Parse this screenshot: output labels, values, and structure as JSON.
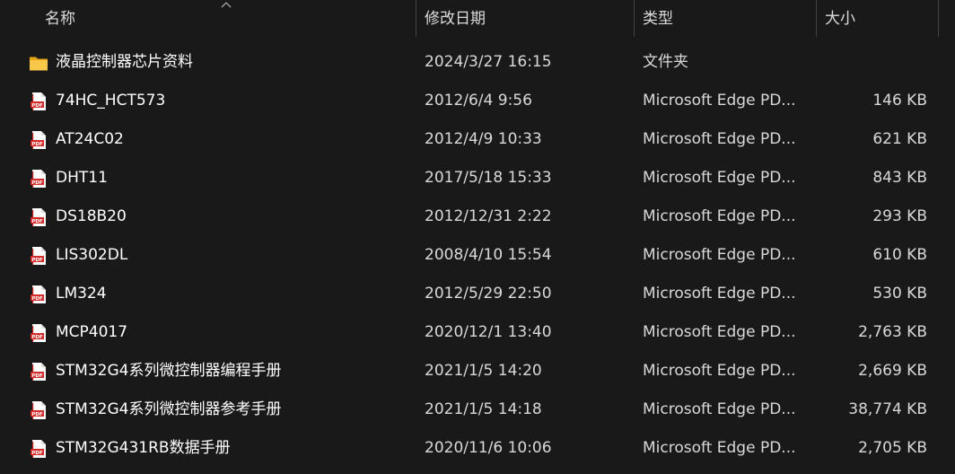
{
  "header": {
    "name": "名称",
    "modified": "修改日期",
    "type": "类型",
    "size": "大小"
  },
  "files": [
    {
      "name": "液晶控制器芯片资料",
      "modified": "2024/3/27 16:15",
      "type": "文件夹",
      "size": "",
      "icon": "folder-icon"
    },
    {
      "name": "74HC_HCT573",
      "modified": "2012/6/4 9:56",
      "type": "Microsoft Edge PD...",
      "size": "146 KB",
      "icon": "pdf-icon"
    },
    {
      "name": "AT24C02",
      "modified": "2012/4/9 10:33",
      "type": "Microsoft Edge PD...",
      "size": "621 KB",
      "icon": "pdf-icon"
    },
    {
      "name": "DHT11",
      "modified": "2017/5/18 15:33",
      "type": "Microsoft Edge PD...",
      "size": "843 KB",
      "icon": "pdf-icon"
    },
    {
      "name": "DS18B20",
      "modified": "2012/12/31 2:22",
      "type": "Microsoft Edge PD...",
      "size": "293 KB",
      "icon": "pdf-icon"
    },
    {
      "name": "LIS302DL",
      "modified": "2008/4/10 15:54",
      "type": "Microsoft Edge PD...",
      "size": "610 KB",
      "icon": "pdf-icon"
    },
    {
      "name": "LM324",
      "modified": "2012/5/29 22:50",
      "type": "Microsoft Edge PD...",
      "size": "530 KB",
      "icon": "pdf-icon"
    },
    {
      "name": "MCP4017",
      "modified": "2020/12/1 13:40",
      "type": "Microsoft Edge PD...",
      "size": "2,763 KB",
      "icon": "pdf-icon"
    },
    {
      "name": "STM32G4系列微控制器编程手册",
      "modified": "2021/1/5 14:20",
      "type": "Microsoft Edge PD...",
      "size": "2,669 KB",
      "icon": "pdf-icon"
    },
    {
      "name": "STM32G4系列微控制器参考手册",
      "modified": "2021/1/5 14:18",
      "type": "Microsoft Edge PD...",
      "size": "38,774 KB",
      "icon": "pdf-icon"
    },
    {
      "name": "STM32G431RB数据手册",
      "modified": "2020/11/6 10:06",
      "type": "Microsoft Edge PD...",
      "size": "2,705 KB",
      "icon": "pdf-icon"
    }
  ],
  "colors": {
    "background": "#191919",
    "separator": "#434343",
    "folder": "#f5c043",
    "pdf_red": "#d42a2a"
  }
}
